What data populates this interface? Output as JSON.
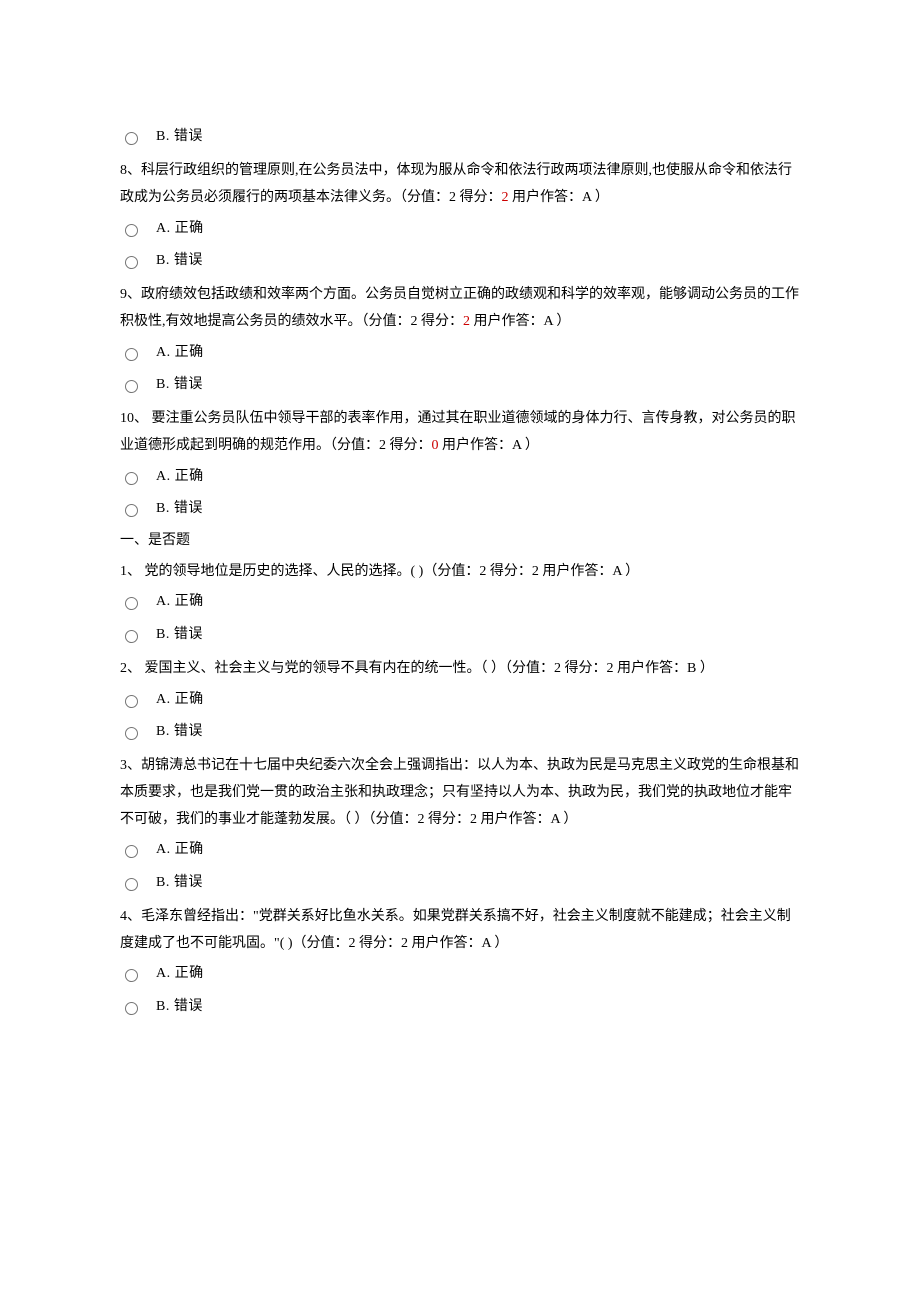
{
  "questions_top": [
    {
      "text_parts": [
        ""
      ],
      "score_parts": [],
      "only_b": true,
      "opt_b": "B.  错误"
    },
    {
      "text_parts": [
        "8、科层行政组织的管理原则,在公务员法中，体现为服从命令和依法行政两项法律原则,也使服从命令和依法行政成为公务员必须履行的两项基本法律义务。（分值：2 得分：",
        " 用户作答：A ）"
      ],
      "score": "2",
      "score_red": true,
      "opt_a": "A.  正确",
      "opt_b": "B.  错误"
    },
    {
      "text_parts": [
        "9、政府绩效包括政绩和效率两个方面。公务员自觉树立正确的政绩观和科学的效率观，能够调动公务员的工作积极性,有效地提高公务员的绩效水平。（分值：2 得分：",
        " 用户作答：A ）"
      ],
      "score": "2",
      "score_red": true,
      "opt_a": "A.  正确",
      "opt_b": "B.  错误"
    },
    {
      "text_parts": [
        "10、 要注重公务员队伍中领导干部的表率作用，通过其在职业道德领域的身体力行、言传身教，对公务员的职业道德形成起到明确的规范作用。（分值：2 得分：",
        " 用户作答：A ）"
      ],
      "score": "0",
      "score_red": true,
      "opt_a": "A.  正确",
      "opt_b": "B.  错误"
    }
  ],
  "section_title": "一、是否题",
  "questions_bottom": [
    {
      "text": "1、 党的领导地位是历史的选择、人民的选择。( )（分值：2 得分：2 用户作答：A ）",
      "opt_a": "A.  正确",
      "opt_b": "B.  错误"
    },
    {
      "text": "2、 爱国主义、社会主义与党的领导不具有内在的统一性。（ ）（分值：2 得分：2 用户作答：B ）",
      "opt_a": "A.  正确",
      "opt_b": "B.  错误"
    },
    {
      "text": "3、胡锦涛总书记在十七届中央纪委六次全会上强调指出：以人为本、执政为民是马克思主义政党的生命根基和本质要求，也是我们党一贯的政治主张和执政理念；只有坚持以人为本、执政为民，我们党的执政地位才能牢不可破，我们的事业才能蓬勃发展。（   ）（分值：2 得分：2 用户作答：A ）",
      "opt_a": "A.  正确",
      "opt_b": "B.  错误"
    },
    {
      "text": "4、毛泽东曾经指出：\"党群关系好比鱼水关系。如果党群关系搞不好，社会主义制度就不能建成；社会主义制度建成了也不可能巩固。\"( )（分值：2 得分：2 用户作答：A ）",
      "opt_a": "A.  正确",
      "opt_b": "B.  错误"
    }
  ]
}
